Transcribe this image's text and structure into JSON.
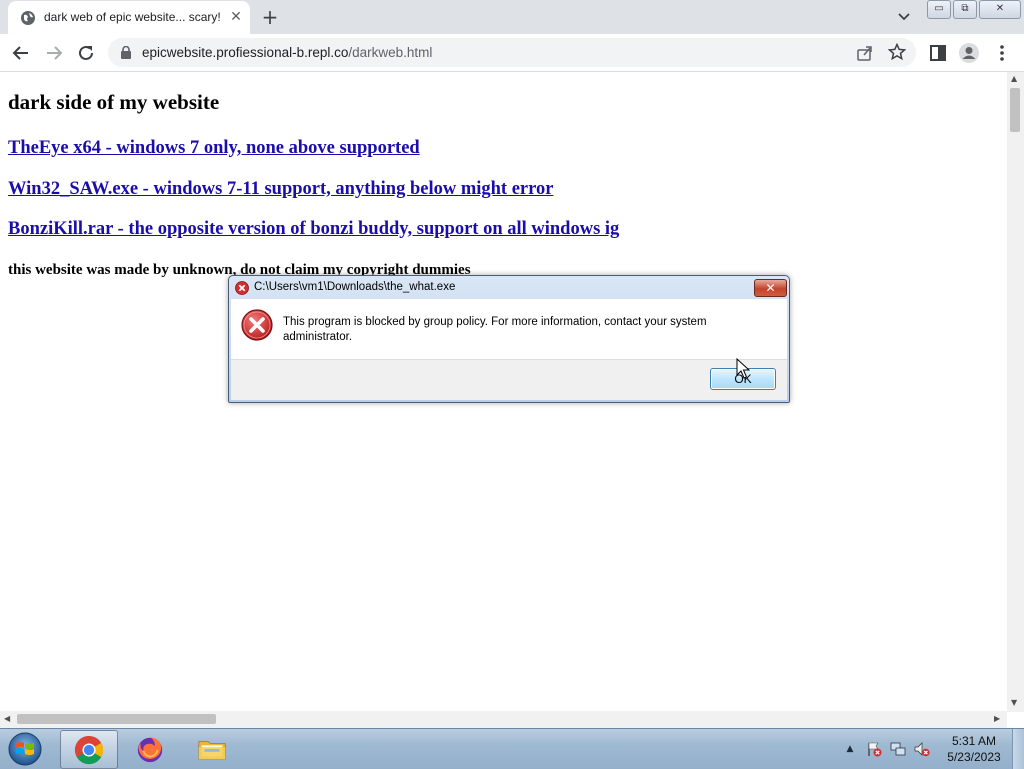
{
  "browser": {
    "tab_title": "dark web of epic website... scary!",
    "tab_close": "✕",
    "new_tab": "+",
    "url_host": "epicwebsite.profiessional-b.repl.co",
    "url_path": "/darkweb.html",
    "window_buttons": {
      "minimize": "▭",
      "restore": "⧉",
      "close": "✕"
    }
  },
  "page": {
    "heading": "dark side of my website",
    "links": [
      "TheEye x64 - windows 7 only, none above supported",
      "Win32_SAW.exe - windows 7-11 support, anything below might error",
      "BonziKill.rar - the opposite version of bonzi buddy, support on all windows ig"
    ],
    "footer": "this website was made by unknown, do not claim my copyright dummies"
  },
  "dialog": {
    "title": "C:\\Users\\vm1\\Downloads\\the_what.exe",
    "message": "This program is blocked by group policy. For more information, contact your system administrator.",
    "ok_label": "OK",
    "close_label": "✕"
  },
  "taskbar": {
    "time": "5:31 AM",
    "date": "5/23/2023",
    "tray_expand": "▲",
    "apps": [
      "chrome",
      "firefox",
      "file-explorer"
    ]
  },
  "colors": {
    "link": "#1a0dab",
    "tab_strip": "#dee1e6",
    "error_red": "#d12f2f"
  }
}
